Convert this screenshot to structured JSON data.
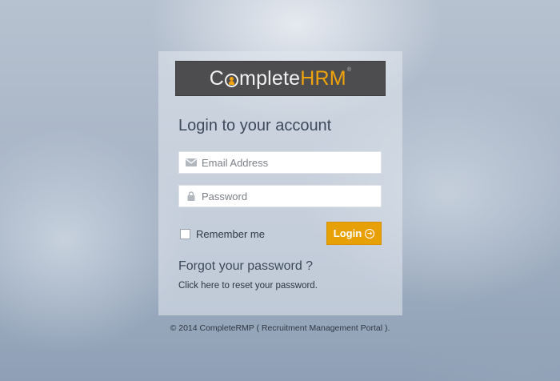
{
  "logo": {
    "part1_a": "C",
    "part1_b": "mplete",
    "part2": "HRM",
    "reg": "®"
  },
  "login": {
    "heading": "Login to your account",
    "email_placeholder": "Email Address",
    "email_value": "",
    "email_icon": "envelope-icon",
    "password_placeholder": "Password",
    "password_value": "",
    "password_icon": "lock-icon",
    "remember_label": "Remember me",
    "remember_checked": false,
    "button_label": "Login",
    "button_icon": "arrow-circle-right-icon",
    "accent_color": "#e8a007"
  },
  "forgot": {
    "title": "Forgot your password ?",
    "text_before": "Click",
    "link": "here",
    "text_after": "to reset your password."
  },
  "footer": {
    "text": "© 2014 CompleteRMP ( Recruitment Management Portal )."
  }
}
